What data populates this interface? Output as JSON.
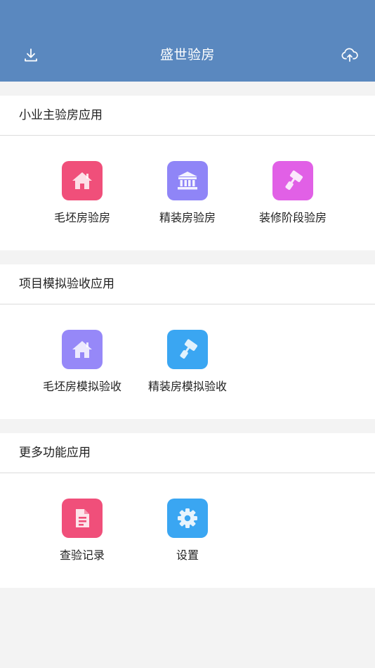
{
  "header": {
    "title": "盛世验房",
    "left_icon": "download-icon",
    "right_icon": "cloud-upload-icon",
    "color": "#5a88bf"
  },
  "sections": [
    {
      "title": "小业主验房应用",
      "apps": [
        {
          "label": "毛坯房验房",
          "icon": "house-icon",
          "color": "#f04f7a"
        },
        {
          "label": "精装房验房",
          "icon": "bank-icon",
          "color": "#8f85f7"
        },
        {
          "label": "装修阶段验房",
          "icon": "paint-roller-icon",
          "color": "#e160e6"
        }
      ]
    },
    {
      "title": "项目模拟验收应用",
      "apps": [
        {
          "label": "毛坯房模拟验收",
          "icon": "house-icon",
          "color": "#9688f8"
        },
        {
          "label": "精装房模拟验收",
          "icon": "paint-roller-icon",
          "color": "#3aa6f2"
        }
      ]
    },
    {
      "title": "更多功能应用",
      "apps": [
        {
          "label": "查验记录",
          "icon": "document-icon",
          "color": "#f04f7a"
        },
        {
          "label": "设置",
          "icon": "gear-icon",
          "color": "#3aa6f2"
        }
      ]
    }
  ]
}
